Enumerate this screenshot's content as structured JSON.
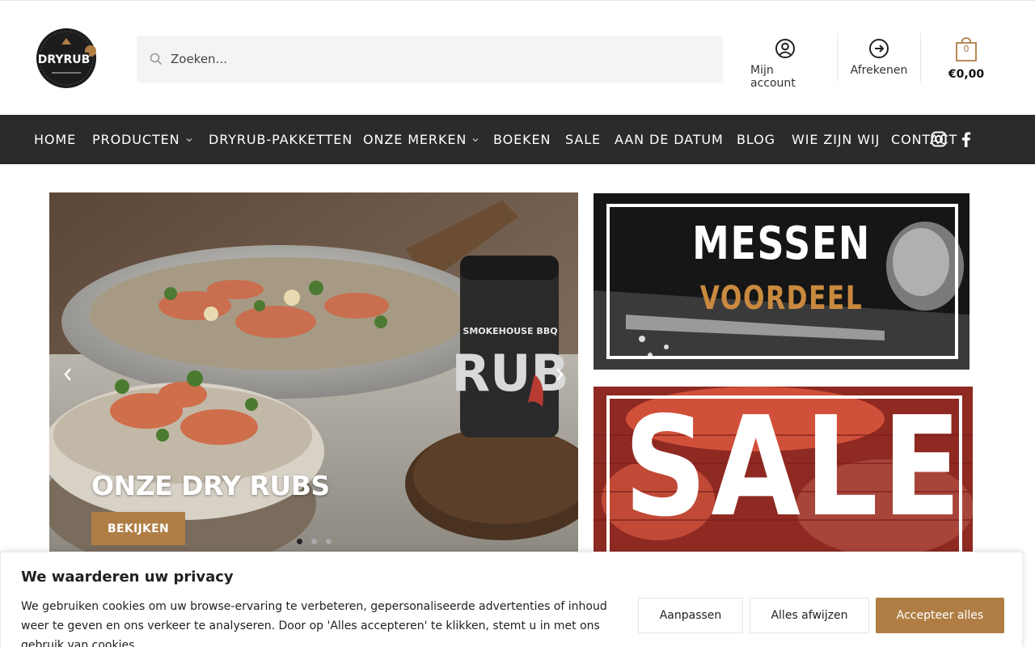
{
  "header": {
    "logo_text": "DRYRUB",
    "search_placeholder": "Zoeken...",
    "account_label": "Mijn account",
    "checkout_label": "Afrekenen",
    "cart_count": "0",
    "cart_total": "€0,00"
  },
  "nav": {
    "items": [
      {
        "label": "HOME",
        "dropdown": false
      },
      {
        "label": "PRODUCTEN",
        "dropdown": true
      },
      {
        "label": "DRYRUB-PAKKETTEN",
        "dropdown": false
      },
      {
        "label": "ONZE MERKEN",
        "dropdown": true
      },
      {
        "label": "BOEKEN",
        "dropdown": false
      },
      {
        "label": "SALE",
        "dropdown": false
      },
      {
        "label": "AAN DE DATUM",
        "dropdown": false
      },
      {
        "label": "BLOG",
        "dropdown": false
      },
      {
        "label": "WIE ZIJN WIJ",
        "dropdown": false
      },
      {
        "label": "CONTACT",
        "dropdown": false
      }
    ],
    "social": [
      "instagram-icon",
      "facebook-icon"
    ]
  },
  "hero": {
    "title": "ONZE DRY RUBS",
    "button_label": "BEKIJKEN",
    "product_label": "SMOKEHOUSE BBQ",
    "product_name": "RUB",
    "slides_total": 3,
    "active_slide": 1
  },
  "promos": {
    "messen_title": "MESSEN",
    "messen_subtitle": "VOORDEEL",
    "sale_title": "SALE"
  },
  "cookie": {
    "title": "We waarderen uw privacy",
    "text": "We gebruiken cookies om uw browse-ervaring te verbeteren, gepersonaliseerde advertenties of inhoud weer te geven en ons verkeer te analyseren. Door op 'Alles accepteren' te klikken, stemt u in met ons gebruik van cookies.",
    "customize_label": "Aanpassen",
    "reject_label": "Alles afwijzen",
    "accept_label": "Accepteer alles"
  },
  "colors": {
    "accent": "#b07e45",
    "nav_bg": "#2b2b2b"
  }
}
